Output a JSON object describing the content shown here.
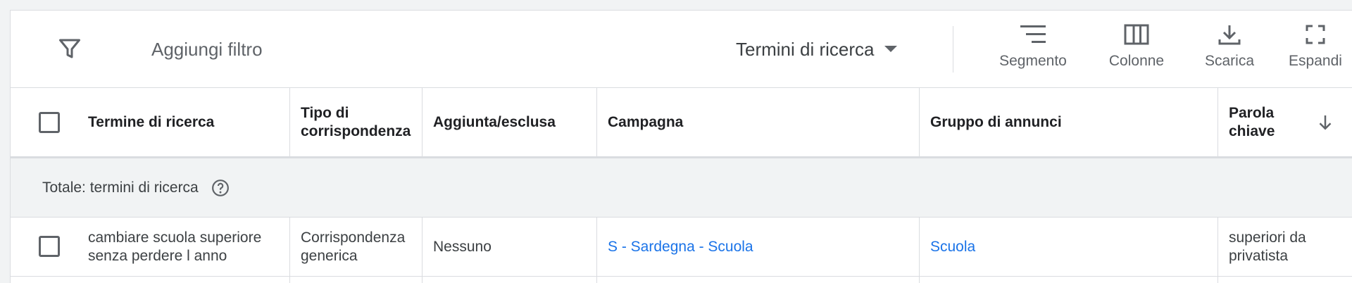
{
  "toolbar": {
    "filter_icon": "filter-icon",
    "add_filter_label": "Aggiungi filtro",
    "view_selector_label": "Termini di ricerca",
    "buttons": [
      {
        "label": "Segmento",
        "icon": "segment-icon"
      },
      {
        "label": "Colonne",
        "icon": "columns-icon"
      },
      {
        "label": "Scarica",
        "icon": "download-icon"
      },
      {
        "label": "Espandi",
        "icon": "expand-icon"
      }
    ]
  },
  "table": {
    "columns": [
      {
        "label": "Termine di ricerca"
      },
      {
        "label": "Tipo di corrispondenza"
      },
      {
        "label": "Aggiunta/esclusa"
      },
      {
        "label": "Campagna"
      },
      {
        "label": "Gruppo di annunci"
      },
      {
        "label": "Parola chiave",
        "sort": "descending"
      }
    ],
    "total_row": {
      "label": "Totale: termini di ricerca",
      "help_icon": "help-icon"
    },
    "rows": [
      {
        "search_term": "cambiare scuola superiore senza perdere l anno",
        "match_type": "Corrispondenza generica",
        "added_excluded": "Nessuno",
        "campaign": "S - Sardegna - Scuola",
        "ad_group": "Scuola",
        "keyword": "superiori da privatista"
      }
    ]
  },
  "colors": {
    "accent_link": "#1a73e8",
    "text": "#3c4043",
    "border": "#dadce0",
    "total_row_bg": "#f1f3f4"
  }
}
